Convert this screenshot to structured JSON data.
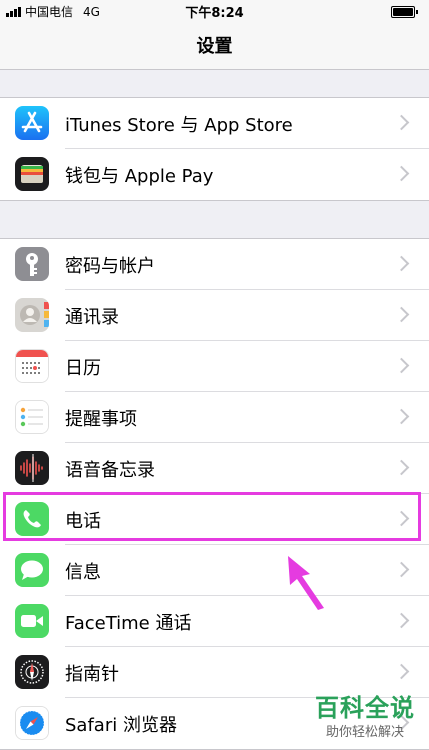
{
  "status": {
    "carrier": "中国电信",
    "network": "4G",
    "time": "下午8:24"
  },
  "nav": {
    "title": "设置"
  },
  "groups": [
    {
      "items": [
        {
          "label": "iTunes Store 与 App Store",
          "icon": "app-store-icon"
        },
        {
          "label": "钱包与 Apple Pay",
          "icon": "wallet-icon"
        }
      ]
    },
    {
      "items": [
        {
          "label": "密码与帐户",
          "icon": "key-icon"
        },
        {
          "label": "通讯录",
          "icon": "contacts-icon"
        },
        {
          "label": "日历",
          "icon": "calendar-icon"
        },
        {
          "label": "提醒事项",
          "icon": "reminders-icon"
        },
        {
          "label": "语音备忘录",
          "icon": "voice-memos-icon"
        },
        {
          "label": "电话",
          "icon": "phone-icon"
        },
        {
          "label": "信息",
          "icon": "messages-icon"
        },
        {
          "label": "FaceTime 通话",
          "icon": "facetime-icon"
        },
        {
          "label": "指南针",
          "icon": "compass-icon"
        },
        {
          "label": "Safari 浏览器",
          "icon": "safari-icon"
        }
      ]
    }
  ],
  "annotation": {
    "color": "#e53be0"
  },
  "watermark": {
    "title": "百科全说",
    "subtitle": "助你轻松解决"
  }
}
